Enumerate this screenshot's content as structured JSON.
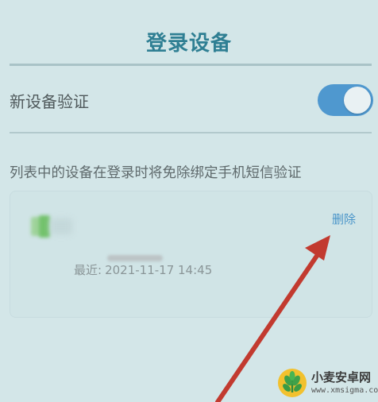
{
  "header": {
    "title": "登录设备"
  },
  "device_verification": {
    "label": "新设备验证",
    "enabled": true,
    "toggle_color": "#4f98cf"
  },
  "description": "列表中的设备在登录时将免除绑定手机短信验证",
  "devices": [
    {
      "recent_label": "最近:",
      "recent_time": "2021-11-17 14:45",
      "delete_label": "删除",
      "delete_color": "#4a95c9"
    }
  ],
  "annotation": {
    "arrow_color": "#c23a2f"
  },
  "watermark": {
    "title": "小麦安卓网",
    "url": "www.xmsigma.com"
  },
  "colors": {
    "background": "#d3e6e8",
    "title": "#2f7f93"
  }
}
